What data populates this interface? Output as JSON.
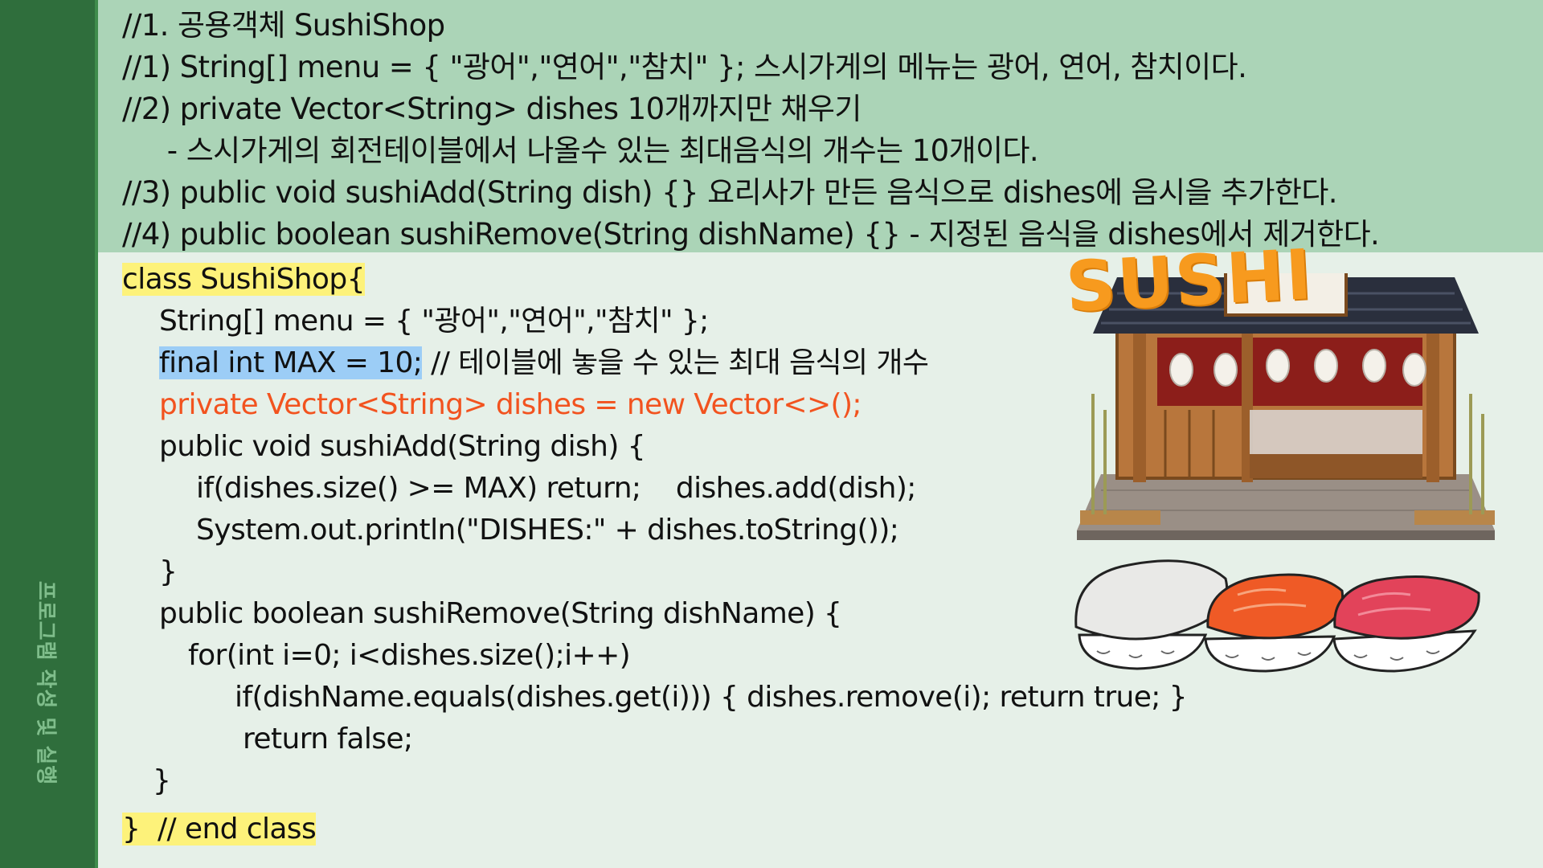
{
  "sidebar": {
    "label": "프로그램 작성 및 실행"
  },
  "header_lines": [
    "//1. 공용객체 SushiShop",
    "//1) String[] menu = { \"광어\",\"연어\",\"참치\" }; 스시가게의 메뉴는 광어, 연어, 참치이다.",
    "//2) private Vector<String> dishes 10개까지만 채우기",
    "     - 스시가게의 회전테이블에서 나올수 있는 최대음식의 개수는 10개이다.",
    "//3) public void sushiAdd(String dish) {} 요리사가 만든 음식으로 dishes에 음시을 추가한다.",
    "//4) public boolean sushiRemove(String dishName) {} - 지정된 음식을 dishes에서 제거한다."
  ],
  "code": {
    "class_open": "class SushiShop{",
    "menu_decl": "String[] menu = { \"광어\",\"연어\",\"참치\" };",
    "max_decl": "final int MAX = 10;",
    "max_comment": " // 테이블에 놓을 수 있는 최대 음식의 개수",
    "dishes_decl": "private Vector<String> dishes = new Vector<>();",
    "add_sig": "public void sushiAdd(String dish) {",
    "add_body1": "if(dishes.size() >= MAX) return;    dishes.add(dish);",
    "add_body2": "System.out.println(\"DISHES:\" + dishes.toString());",
    "add_close": "}",
    "remove_sig": "public boolean sushiRemove(String dishName) {",
    "remove_for": "for(int i=0; i<dishes.size();i++)",
    "remove_if": "if(dishName.equals(dishes.get(i))) { dishes.remove(i); return true; }",
    "remove_return": "return false;",
    "remove_close": "}",
    "class_close": "}  // end class"
  },
  "illustration": {
    "sign_text": "SUSHI"
  },
  "colors": {
    "sidebar": "#2f6e3c",
    "top_panel": "#abd4b7",
    "main_bg": "#e6f0e8",
    "highlight_yellow": "#fdf27a",
    "highlight_blue": "#9ccdf6",
    "code_red": "#f2531f",
    "sign_orange": "#f79a1e"
  }
}
